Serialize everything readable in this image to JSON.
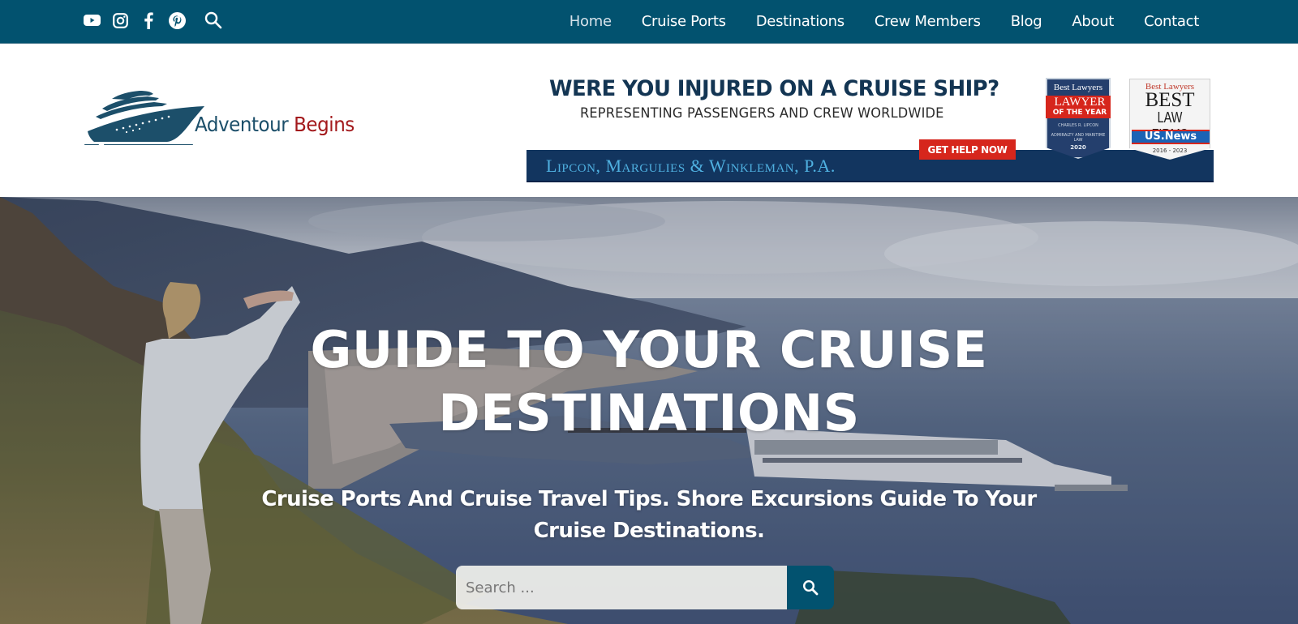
{
  "topbar": {
    "social_icons": [
      {
        "name": "youtube-icon",
        "label": "YouTube"
      },
      {
        "name": "instagram-icon",
        "label": "Instagram"
      },
      {
        "name": "facebook-icon",
        "label": "Facebook"
      },
      {
        "name": "pinterest-icon",
        "label": "Pinterest"
      }
    ],
    "search_icon": "search-icon",
    "nav": [
      {
        "label": "Home",
        "active": true
      },
      {
        "label": "Cruise Ports",
        "active": false
      },
      {
        "label": "Destinations",
        "active": false
      },
      {
        "label": "Crew Members",
        "active": false
      },
      {
        "label": "Blog",
        "active": false
      },
      {
        "label": "About",
        "active": false
      },
      {
        "label": "Contact",
        "active": false
      }
    ]
  },
  "header": {
    "logo": {
      "icon": "cruise-ship-icon",
      "brand_part1": "Adventour",
      "brand_part2": "Begins"
    },
    "ad": {
      "headline": "WERE YOU INJURED ON A CRUISE SHIP?",
      "subheadline": "REPRESENTING PASSENGERS AND CREW WORLDWIDE",
      "firm": "Lipcon, Margulies & Winkleman, P.A.",
      "cta": "GET HELP NOW",
      "badge1": {
        "top": "Best Lawyers",
        "title": "LAWYER",
        "subtitle": "OF THE YEAR",
        "name": "CHARLES R. LIPCON",
        "area": "ADMIRALTY AND MARITIME LAW",
        "year": "2020"
      },
      "badge2": {
        "top": "Best Lawyers",
        "title": "BEST",
        "subtitle": "LAW FIRMS",
        "ribbon": "US.News",
        "years": "2016 - 2023"
      }
    }
  },
  "hero": {
    "title_line1": "GUIDE TO YOUR CRUISE",
    "title_line2": "DESTINATIONS",
    "subtitle": "Cruise Ports And Cruise Travel Tips. Shore Excursions Guide To Your Cruise Destinations.",
    "search": {
      "placeholder": "Search ...",
      "value": ""
    }
  },
  "colors": {
    "topbar_bg": "#02526f",
    "brand_blue": "#1c4f6a",
    "brand_red": "#a3191c",
    "ad_navy": "#12355f",
    "ad_cta_red": "#d6261c"
  }
}
